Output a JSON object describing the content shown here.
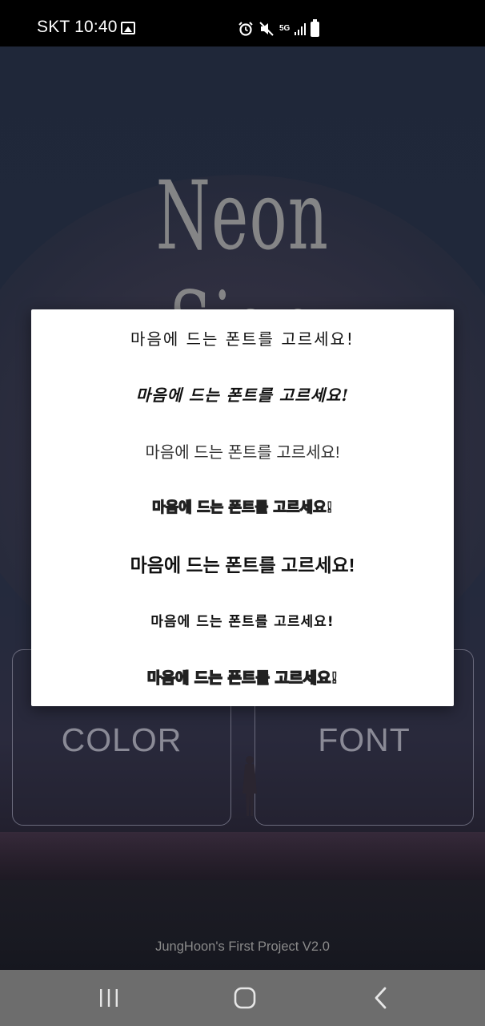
{
  "status_bar": {
    "carrier_time": "SKT 10:40",
    "icons": [
      "gallery-icon",
      "alarm-icon",
      "mute-icon",
      "5g-icon",
      "signal-icon",
      "battery-icon"
    ],
    "network_label": "5G"
  },
  "app": {
    "title": "Neon Sign",
    "buttons": {
      "color_label": "COLOR",
      "font_label": "FONT"
    },
    "footer": "JungHoon's First Project V2.0"
  },
  "font_dialog": {
    "options": [
      {
        "label": "마음에 드는 폰트를 고르세요!"
      },
      {
        "label": "마음에 드는 폰트를 고르세요!"
      },
      {
        "label": "마음에 드는 폰트를 고르세요!"
      },
      {
        "label": "마음에 드는 폰트를 고르세요!"
      },
      {
        "label": "마음에 드는 폰트를 고르세요!"
      },
      {
        "label": "마음에 드는 폰트를 고르세요!"
      },
      {
        "label": "마음에 드는 폰트를 고르세요!"
      }
    ]
  },
  "nav_bar": {
    "icons": [
      "recent-apps-icon",
      "home-icon",
      "back-icon"
    ]
  },
  "colors": {
    "dialog_bg": "#ffffff",
    "title_gray": "#8f8f8f",
    "nav_bar_bg": "#6d6d6d",
    "status_bar_bg": "#000000"
  }
}
